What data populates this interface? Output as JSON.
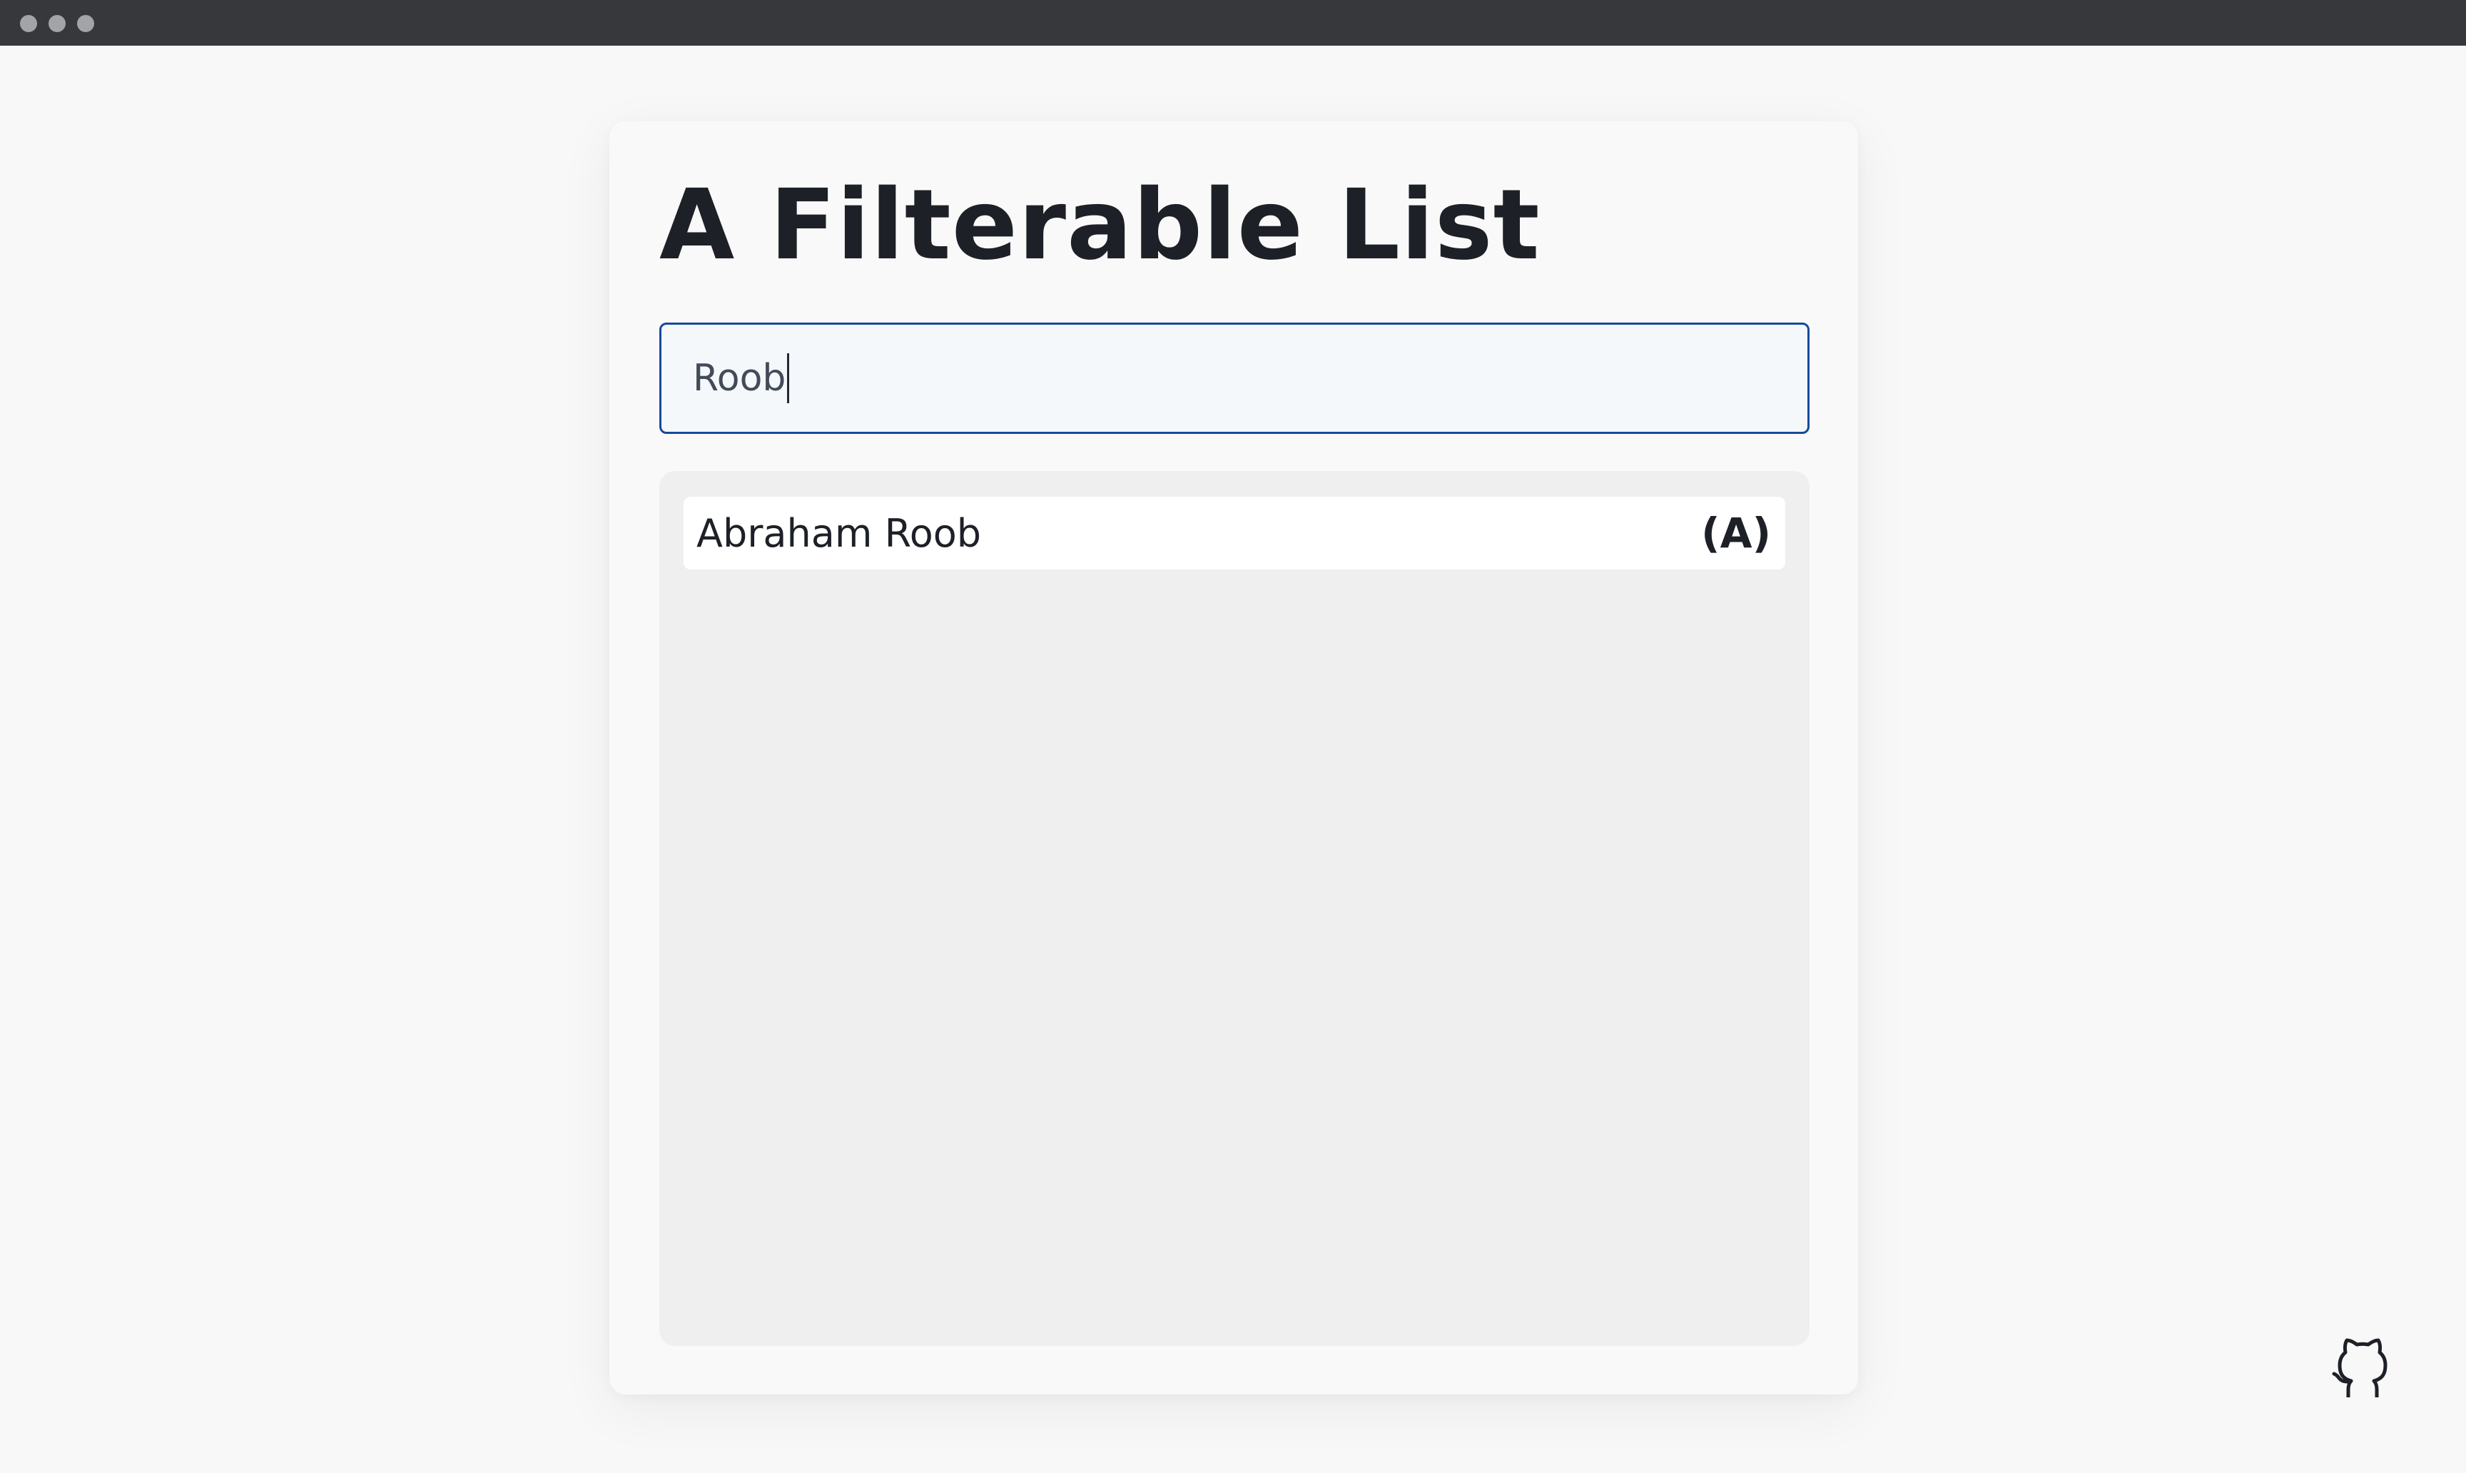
{
  "window": {
    "controls": [
      "window-dot-icon",
      "window-dot-icon",
      "window-dot-icon"
    ]
  },
  "page": {
    "title": "A Filterable List"
  },
  "search": {
    "value": "Roob"
  },
  "list": {
    "items": [
      {
        "name": "Abraham Roob",
        "badge": "(A)"
      }
    ]
  },
  "footer": {
    "icon": "github-icon"
  },
  "colors": {
    "background": "#f8f8f8",
    "titlebar": "#37383b",
    "input_border": "#174a9a",
    "list_background": "#efefef",
    "text": "#1d2127"
  }
}
